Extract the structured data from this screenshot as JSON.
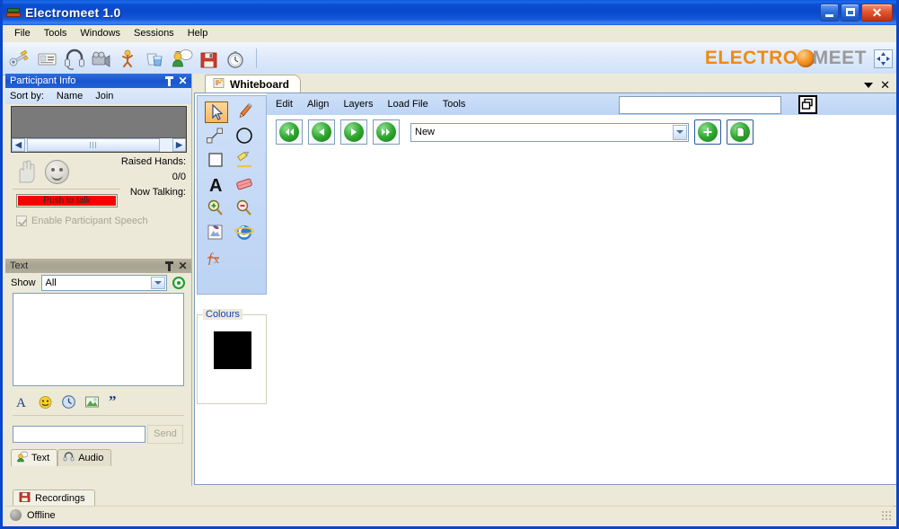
{
  "window": {
    "title": "Electromeet 1.0",
    "icon": "app-icon",
    "buttons": {
      "minimize": "_",
      "maximize": "□",
      "close": "✕"
    }
  },
  "menubar": {
    "items": [
      {
        "label": "File"
      },
      {
        "label": "Tools"
      },
      {
        "label": "Windows"
      },
      {
        "label": "Sessions"
      },
      {
        "label": "Help"
      }
    ]
  },
  "toolbar": {
    "icons": [
      {
        "name": "tools-key-icon"
      },
      {
        "name": "card-info-icon"
      },
      {
        "name": "headset-icon"
      },
      {
        "name": "camera-icon"
      },
      {
        "name": "presenter-icon"
      },
      {
        "name": "water-glass-icon"
      },
      {
        "name": "participant-speech-icon"
      },
      {
        "name": "save-floppy-icon"
      },
      {
        "name": "timer-clock-icon"
      }
    ],
    "brand": {
      "first": "ELECTRO",
      "second": "MEET"
    },
    "expand_label": "expand-icon"
  },
  "participant_panel": {
    "title": "Participant Info",
    "pin": "pin-icon",
    "close": "✕",
    "sort": {
      "label": "Sort by:",
      "options": [
        "Name",
        "Join"
      ]
    },
    "list_items": [],
    "raised_hands_label": "Raised Hands:",
    "raised_hands_value": "0/0",
    "now_talking_label": "Now Talking:",
    "now_talking_value": "",
    "push_to_talk": "Push to talk",
    "enable_speech": "Enable Participant Speech"
  },
  "text_panel": {
    "title": "Text",
    "pin": "pin-icon",
    "close": "✕",
    "show_label": "Show",
    "show_value": "All",
    "show_options": [
      "All"
    ],
    "chat_log": "",
    "tools": [
      {
        "name": "font-icon",
        "glyph": "A"
      },
      {
        "name": "emoticon-icon"
      },
      {
        "name": "timestamp-clock-icon"
      },
      {
        "name": "image-icon"
      },
      {
        "name": "quote-icon"
      }
    ],
    "input_value": "",
    "send_label": "Send",
    "tabs": [
      {
        "label": "Text",
        "icon": "person-chat-icon",
        "active": true
      },
      {
        "label": "Audio",
        "icon": "headset-icon",
        "active": false
      }
    ]
  },
  "whiteboard": {
    "tab_label": "Whiteboard",
    "tab_icon": "whiteboard-icon",
    "panel_caret": "▼",
    "panel_close": "✕",
    "menu": [
      {
        "label": "Edit"
      },
      {
        "label": "Align"
      },
      {
        "label": "Layers"
      },
      {
        "label": "Load File"
      },
      {
        "label": "Tools"
      }
    ],
    "top_input_value": "",
    "restore_button": "restore-windows-icon",
    "tools": [
      {
        "name": "pointer-tool",
        "selected": true
      },
      {
        "name": "pencil-tool",
        "selected": false
      },
      {
        "name": "polyline-tool",
        "selected": false
      },
      {
        "name": "ellipse-tool",
        "selected": false
      },
      {
        "name": "rectangle-tool",
        "selected": false
      },
      {
        "name": "highlighter-tool",
        "selected": false
      },
      {
        "name": "text-tool",
        "selected": false
      },
      {
        "name": "eraser-tool",
        "selected": false
      },
      {
        "name": "zoom-in-tool",
        "selected": false
      },
      {
        "name": "zoom-out-tool",
        "selected": false
      },
      {
        "name": "insert-image-tool",
        "selected": false
      },
      {
        "name": "web-browser-tool",
        "selected": false
      },
      {
        "name": "formula-tool",
        "selected": false
      }
    ],
    "colours_label": "Colours",
    "current_colour": "#000000",
    "nav": [
      {
        "name": "first-page-button",
        "glyph": "◀◀"
      },
      {
        "name": "previous-page-button",
        "glyph": "◀"
      },
      {
        "name": "next-page-button",
        "glyph": "▶"
      },
      {
        "name": "last-page-button",
        "glyph": "▶▶"
      }
    ],
    "page_value": "New",
    "page_options": [
      "New"
    ],
    "add_button": "add-page-button",
    "new_page_button": "new-page-button"
  },
  "recordings": {
    "tab_label": "Recordings",
    "tab_icon": "recordings-floppy-icon"
  },
  "statusbar": {
    "status": "Offline",
    "status_color": "#9c9c96"
  }
}
